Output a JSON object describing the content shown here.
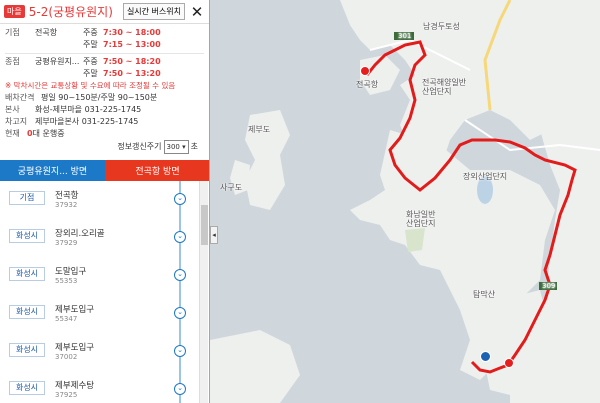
{
  "header": {
    "badge": "마을",
    "route_name": "5-2(궁평유원지)",
    "timetable_button": "실시간 버스위치",
    "close_glyph": "✕"
  },
  "info": {
    "origin_label": "기점",
    "origin_value": "전곡항",
    "weekday_label": "주중",
    "origin_weekday": "7:30 ~ 18:00",
    "weekend_label": "주말",
    "origin_weekend": "7:15 ~ 13:00",
    "dest_label": "종점",
    "dest_value": "궁평유원지...",
    "dest_weekday": "7:50 ~ 18:20",
    "dest_weekend": "7:50 ~ 13:20",
    "notice": "※ 막차시간은 교통상황 및 수요에 따라 조정될 수 있음",
    "interval_label": "배차간격",
    "interval_value": "평일 90~150분/주말 90~150분",
    "office_label": "본사",
    "office_value": "화성-제부마을 031-225-1745",
    "garage_label": "차고지",
    "garage_value": "제부마을본사 031-225-1745",
    "current_label": "현재",
    "current_count": "0",
    "current_suffix": "대 운행중",
    "refresh_label": "정보갱신주기",
    "refresh_value": "300",
    "refresh_unit": "초"
  },
  "tabs": {
    "tab1": "궁평유원지... 방면",
    "tab2": "전곡항 방면"
  },
  "stops": [
    {
      "area": "기점",
      "name": "전곡항",
      "id": "37932"
    },
    {
      "area": "화성시",
      "name": "장외리.오리골",
      "id": "37929"
    },
    {
      "area": "화성시",
      "name": "도말입구",
      "id": "55353"
    },
    {
      "area": "화성시",
      "name": "제부도입구",
      "id": "55347"
    },
    {
      "area": "화성시",
      "name": "제부도입구",
      "id": "37002"
    },
    {
      "area": "화성시",
      "name": "제부제수탕",
      "id": "37925"
    }
  ],
  "map": {
    "labels": {
      "namyang": "남경두토성",
      "jeongok": "전곡항",
      "jeongok_ind": "전곡해양일반\n산업단지",
      "jebu": "제부도",
      "sagu": "사구도",
      "jangan": "장외산업단지",
      "hwaseong": "화남일반\n산업단지",
      "tangmak": "탐막산",
      "road": "301",
      "road2": "309"
    },
    "route_color": "#e21b1b"
  }
}
